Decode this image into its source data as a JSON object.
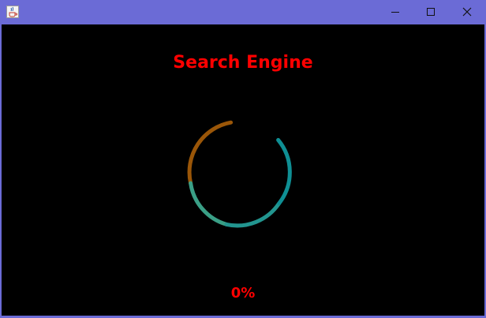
{
  "window": {
    "icon": "java-cup-icon",
    "controls": {
      "minimize_icon": "minimize-icon",
      "maximize_icon": "maximize-icon",
      "close_icon": "close-icon"
    },
    "titlebar_color": "#6b6bd6"
  },
  "main": {
    "title": "Search Engine",
    "progress_text": "0%",
    "progress_value": 0,
    "spinner": {
      "type": "circular-loading-indicator",
      "colors": [
        "#8a4a0a",
        "#a85f00",
        "#3aa08a",
        "#0a8a8a",
        "#1ea0a0"
      ]
    },
    "text_color": "#ff0000",
    "background": "#000000"
  }
}
